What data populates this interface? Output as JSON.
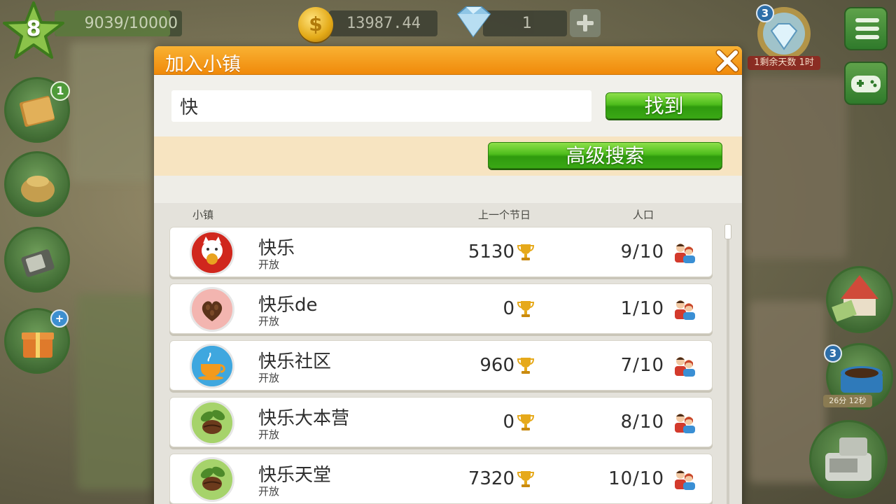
{
  "hud": {
    "level": "8",
    "xp": "9039/10000",
    "xp_progress": 0.9039,
    "coins": "13987.44",
    "gems": "1",
    "event_badge_count": "3",
    "event_timer": "1剩余天数 1时",
    "coffee_badge_count": "3",
    "coffee_timer": "26分 12秒",
    "book_badge_count": "1",
    "gift_badge_count": "+"
  },
  "dialog": {
    "title": "加入小镇",
    "search": {
      "value": "快",
      "find_label": "找到"
    },
    "advanced_search_label": "高级搜索",
    "columns": {
      "town": "小镇",
      "last_festival": "上一个节日",
      "population": "人口"
    },
    "towns": [
      {
        "name": "快乐",
        "status": "开放",
        "score": "5130",
        "population": "9/10",
        "avatar": "lucky-cat-icon"
      },
      {
        "name": "快乐de",
        "status": "开放",
        "score": "0",
        "population": "1/10",
        "avatar": "coffee-beans-heart-icon"
      },
      {
        "name": "快乐社区",
        "status": "开放",
        "score": "960",
        "population": "7/10",
        "avatar": "coffee-cup-icon"
      },
      {
        "name": "快乐大本营",
        "status": "开放",
        "score": "0",
        "population": "8/10",
        "avatar": "coffee-bean-leaf-icon"
      },
      {
        "name": "快乐天堂",
        "status": "开放",
        "score": "7320",
        "population": "10/10",
        "avatar": "coffee-bean-leaf-icon"
      }
    ]
  },
  "colors": {
    "header_orange": "#f49c1c",
    "green_button": "#4ebd1c",
    "advanced_band": "#f7e4c1"
  }
}
